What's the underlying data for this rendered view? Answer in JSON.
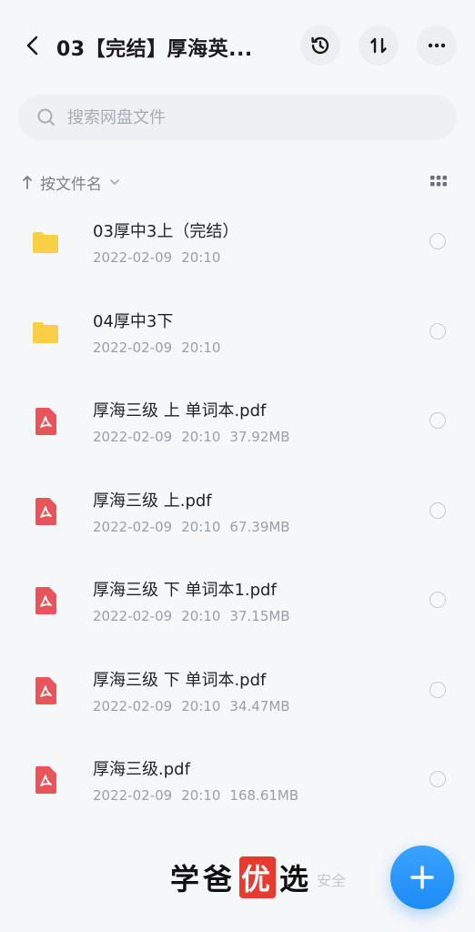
{
  "header": {
    "title": "03【完结】厚海英...",
    "back_icon": "chevron-left-icon",
    "history_icon": "clock-history-icon",
    "transfer_icon": "up-down-arrows-icon",
    "more_icon": "more-horizontal-icon"
  },
  "search": {
    "placeholder": "搜索网盘文件"
  },
  "sort": {
    "label": "按文件名"
  },
  "files": [
    {
      "type": "folder",
      "name": "03厚中3上（完结）",
      "date": "2022-02-09",
      "time": "20:10",
      "size": ""
    },
    {
      "type": "folder",
      "name": "04厚中3下",
      "date": "2022-02-09",
      "time": "20:10",
      "size": ""
    },
    {
      "type": "pdf",
      "name": "厚海三级 上 单词本.pdf",
      "date": "2022-02-09",
      "time": "20:10",
      "size": "37.92MB"
    },
    {
      "type": "pdf",
      "name": "厚海三级 上.pdf",
      "date": "2022-02-09",
      "time": "20:10",
      "size": "67.39MB"
    },
    {
      "type": "pdf",
      "name": "厚海三级 下 单词本1.pdf",
      "date": "2022-02-09",
      "time": "20:10",
      "size": "37.15MB"
    },
    {
      "type": "pdf",
      "name": "厚海三级 下 单词本.pdf",
      "date": "2022-02-09",
      "time": "20:10",
      "size": "34.47MB"
    },
    {
      "type": "pdf",
      "name": "厚海三级.pdf",
      "date": "2022-02-09",
      "time": "20:10",
      "size": "168.61MB"
    }
  ],
  "watermark": {
    "sub_text": "安全",
    "main_pre": "学爸",
    "main_highlight": "优",
    "main_post": "选"
  },
  "colors": {
    "accent": "#1d8bf5",
    "folder": "#f9cf45",
    "pdf": "#e9545a"
  }
}
